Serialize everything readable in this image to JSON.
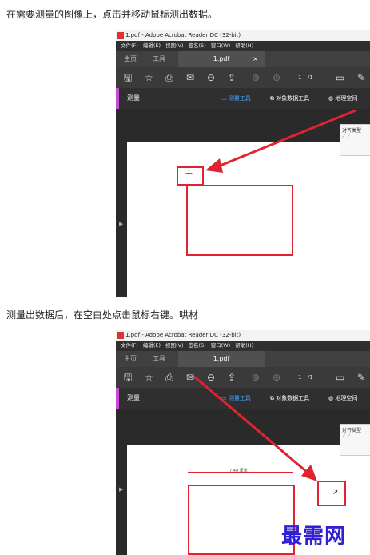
{
  "step1": {
    "caption": "在需要测量的图像上，点击并移动鼠标测出数据。"
  },
  "step2": {
    "caption": "测量出数据后，在空白处点击鼠标右键。哄材"
  },
  "app": {
    "title": "1.pdf - Adobe Acrobat Reader DC (32-bit)",
    "menu": [
      "文件(F)",
      "编辑(E)",
      "视图(V)",
      "签名(S)",
      "窗口(W)",
      "帮助(H)"
    ],
    "tabs": {
      "home": "主页",
      "tools": "工具",
      "doc": "1.pdf",
      "close": "×"
    },
    "page_indicator": {
      "current": "1",
      "total": "/1"
    },
    "measure_bar": {
      "label": "测量",
      "measure_tool": "测量工具",
      "object_data_tool": "对象数据工具",
      "geo_tool": "地理空间"
    },
    "popover": {
      "title": "对齐类型"
    },
    "dimension": "7.40 厘米"
  },
  "icons": [
    "pdf-icon",
    "save-icon",
    "star-icon",
    "print-icon",
    "mail-icon",
    "zoom-icon",
    "upload-icon",
    "page-up-icon",
    "page-down-icon",
    "comment-icon",
    "pen-icon",
    "ruler-icon",
    "object-data-icon",
    "globe-icon",
    "crosshair-icon",
    "cursor-icon"
  ],
  "colors": {
    "accent": "#c84bd4",
    "annotation_red": "#e0232e",
    "link_blue": "#4aa3ff",
    "watermark": "#2f1fd6"
  },
  "watermark": "最需网"
}
